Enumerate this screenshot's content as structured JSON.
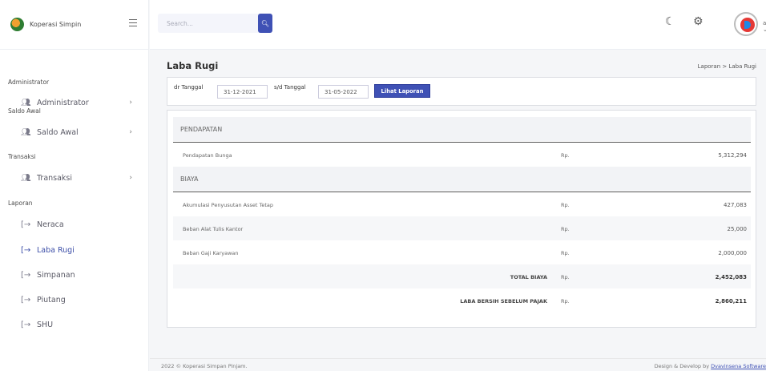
{
  "brand": {
    "name": "Koperasi Simpin"
  },
  "search": {
    "placeholder": "Search..."
  },
  "user": {
    "label": "a ⌄"
  },
  "sidebar": {
    "sections": [
      {
        "title": "Administrator"
      },
      {
        "title": "Saldo Awal"
      },
      {
        "title": "Transaksi"
      },
      {
        "title": "Laporan"
      }
    ],
    "items": [
      {
        "label": "Administrator",
        "icon": "users-icon"
      },
      {
        "label": "Saldo Awal",
        "icon": "users-icon"
      },
      {
        "label": "Transaksi",
        "icon": "users-icon"
      },
      {
        "label": "Neraca",
        "icon": "login-arrow-icon"
      },
      {
        "label": "Laba Rugi",
        "icon": "login-arrow-icon"
      },
      {
        "label": "Simpanan",
        "icon": "login-arrow-icon"
      },
      {
        "label": "Piutang",
        "icon": "login-arrow-icon"
      },
      {
        "label": "SHU",
        "icon": "login-arrow-icon"
      }
    ]
  },
  "page": {
    "title": "Laba Rugi",
    "breadcrumb": "Laporan  > Laba Rugi"
  },
  "filter": {
    "from_label": "dr Tanggal",
    "from_value": "31-12-2021",
    "to_label": "s/d Tanggal",
    "to_value": "31-05-2022",
    "button_label": "Lihat Laporan"
  },
  "report": {
    "income_header": "PENDAPATAN",
    "income": [
      {
        "name": "Pendapatan Bunga",
        "currency": "Rp.",
        "amount": "5,312,294"
      }
    ],
    "expense_header": "BIAYA",
    "expenses": [
      {
        "name": "Akumulasi Penyusutan Asset Tetap",
        "currency": "Rp.",
        "amount": "427,083"
      },
      {
        "name": "Beban Alat Tulis Kantor",
        "currency": "Rp.",
        "amount": "25,000"
      },
      {
        "name": "Beban Gaji Karyawan",
        "currency": "Rp.",
        "amount": "2,000,000"
      }
    ],
    "total_cost": {
      "label": "TOTAL BIAYA",
      "currency": "Rp.",
      "amount": "2,452,083"
    },
    "net_profit": {
      "label": "LABA BERSIH SEBELUM PAJAK",
      "currency": "Rp.",
      "amount": "2,860,211"
    }
  },
  "footer": {
    "copyright": "2022 © Koperasi Simpan Pinjam.",
    "credit": "Design & Develop by",
    "credit_link": "Dvavinsena Software"
  }
}
